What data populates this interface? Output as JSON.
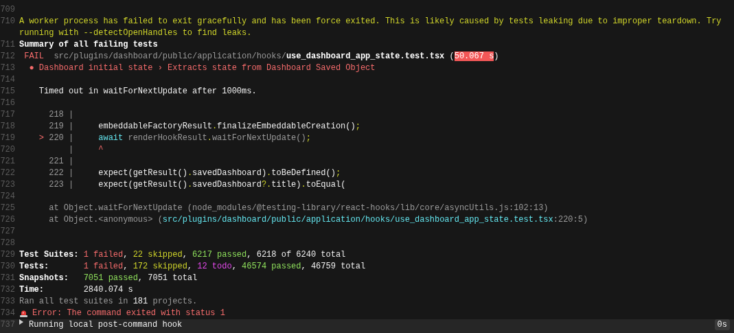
{
  "lines": [
    {
      "number": "709"
    },
    {
      "number": "710",
      "segments": [
        {
          "t": "A worker process has failed to exit gracefully and has been force exited. This is likely caused by tests leaking due to improper teardown. Try running with --detectOpenHandles to find leaks.",
          "kind": "yellow"
        }
      ]
    },
    {
      "number": "711",
      "segments": [
        {
          "t": "Summary of all failing tests",
          "kind": "bold"
        }
      ]
    },
    {
      "number": "712",
      "segments": [
        {
          "t": " FAIL",
          "kind": "red"
        },
        {
          "t": "  src/plugins/dashboard/public/application/hooks/",
          "kind": "dim"
        },
        {
          "t": "use_dashboard_app_state.test.tsx",
          "kind": "bold"
        },
        {
          "t": " (",
          "kind": "plain"
        },
        {
          "t": "50.067 s",
          "kind": "highlight"
        },
        {
          "t": ")",
          "kind": "plain"
        }
      ]
    },
    {
      "number": "713",
      "segments": [
        {
          "t": "  ● Dashboard initial state › Extracts state from Dashboard Saved Object",
          "kind": "red"
        }
      ]
    },
    {
      "number": "714"
    },
    {
      "number": "715",
      "segments": [
        {
          "t": "    Timed out in waitForNextUpdate after 1000ms.",
          "kind": "plain"
        }
      ]
    },
    {
      "number": "716"
    },
    {
      "number": "717",
      "segments": [
        {
          "t": "      218 |",
          "kind": "dim"
        }
      ]
    },
    {
      "number": "718",
      "segments": [
        {
          "t": "      219 |",
          "kind": "dim"
        },
        {
          "t": "     embeddableFactoryResult",
          "kind": "plain"
        },
        {
          "t": ".",
          "kind": "yellow"
        },
        {
          "t": "finalizeEmbeddableCreation()",
          "kind": "plain"
        },
        {
          "t": ";",
          "kind": "yellow"
        }
      ]
    },
    {
      "number": "719",
      "segments": [
        {
          "t": "    > ",
          "kind": "red"
        },
        {
          "t": "220 |",
          "kind": "dim"
        },
        {
          "t": "     await",
          "kind": "cyan"
        },
        {
          "t": " renderHookResult",
          "kind": "dim"
        },
        {
          "t": ".",
          "kind": "yellow"
        },
        {
          "t": "waitForNextUpdate()",
          "kind": "dim"
        },
        {
          "t": ";",
          "kind": "yellow"
        }
      ]
    },
    {
      "number": "720",
      "segments": [
        {
          "t": "          |",
          "kind": "dim"
        },
        {
          "t": "     ^",
          "kind": "red"
        }
      ]
    },
    {
      "number": "721",
      "segments": [
        {
          "t": "      221 |",
          "kind": "dim"
        }
      ]
    },
    {
      "number": "722",
      "segments": [
        {
          "t": "      222 |",
          "kind": "dim"
        },
        {
          "t": "     expect(getResult()",
          "kind": "plain"
        },
        {
          "t": ".",
          "kind": "yellow"
        },
        {
          "t": "savedDashboard)",
          "kind": "plain"
        },
        {
          "t": ".",
          "kind": "yellow"
        },
        {
          "t": "toBeDefined()",
          "kind": "plain"
        },
        {
          "t": ";",
          "kind": "yellow"
        }
      ]
    },
    {
      "number": "723",
      "segments": [
        {
          "t": "      223 |",
          "kind": "dim"
        },
        {
          "t": "     expect(getResult()",
          "kind": "plain"
        },
        {
          "t": ".",
          "kind": "yellow"
        },
        {
          "t": "savedDashboard",
          "kind": "plain"
        },
        {
          "t": "?.",
          "kind": "yellow"
        },
        {
          "t": "title)",
          "kind": "plain"
        },
        {
          "t": ".",
          "kind": "yellow"
        },
        {
          "t": "toEqual(",
          "kind": "plain"
        }
      ]
    },
    {
      "number": "724"
    },
    {
      "number": "725",
      "segments": [
        {
          "t": "      at Object.waitForNextUpdate (node_modules/@testing-library/react-hooks/lib/core/asyncUtils.js:102:13)",
          "kind": "dim"
        }
      ]
    },
    {
      "number": "726",
      "segments": [
        {
          "t": "      at Object.<anonymous> (",
          "kind": "dim"
        },
        {
          "t": "src/plugins/dashboard/public/application/hooks/use_dashboard_app_state.test.tsx",
          "kind": "cyan"
        },
        {
          "t": ":220:5)",
          "kind": "dim"
        }
      ]
    },
    {
      "number": "727"
    },
    {
      "number": "728"
    },
    {
      "number": "729",
      "segments": [
        {
          "t": "Test Suites: ",
          "kind": "bold"
        },
        {
          "t": "1 failed",
          "kind": "red"
        },
        {
          "t": ", ",
          "kind": "plain"
        },
        {
          "t": "22 skipped",
          "kind": "yellow"
        },
        {
          "t": ", ",
          "kind": "plain"
        },
        {
          "t": "6217 passed",
          "kind": "green"
        },
        {
          "t": ", 6218 of 6240 total",
          "kind": "plain"
        }
      ]
    },
    {
      "number": "730",
      "segments": [
        {
          "t": "Tests:       ",
          "kind": "bold"
        },
        {
          "t": "1 failed",
          "kind": "red"
        },
        {
          "t": ", ",
          "kind": "plain"
        },
        {
          "t": "172 skipped",
          "kind": "yellow"
        },
        {
          "t": ", ",
          "kind": "plain"
        },
        {
          "t": "12 todo",
          "kind": "magenta"
        },
        {
          "t": ", ",
          "kind": "plain"
        },
        {
          "t": "46574 passed",
          "kind": "green"
        },
        {
          "t": ", 46759 total",
          "kind": "plain"
        }
      ]
    },
    {
      "number": "731",
      "segments": [
        {
          "t": "Snapshots:   ",
          "kind": "bold"
        },
        {
          "t": "7051 passed",
          "kind": "green"
        },
        {
          "t": ", 7051 total",
          "kind": "plain"
        }
      ]
    },
    {
      "number": "732",
      "segments": [
        {
          "t": "Time:        ",
          "kind": "bold"
        },
        {
          "t": "2840.074 s",
          "kind": "plain"
        }
      ]
    },
    {
      "number": "733",
      "segments": [
        {
          "t": "Ran all test suites in ",
          "kind": "dim"
        },
        {
          "t": "181",
          "kind": "plain"
        },
        {
          "t": " projects.",
          "kind": "dim"
        }
      ]
    },
    {
      "number": "734",
      "kind": "alert",
      "segments": [
        {
          "t": "Error: The command exited with status 1",
          "kind": "red"
        }
      ]
    },
    {
      "number": "737",
      "kind": "section",
      "duration": "0s",
      "segments": [
        {
          "t": "Running local post-command hook",
          "kind": "plain"
        }
      ]
    }
  ]
}
